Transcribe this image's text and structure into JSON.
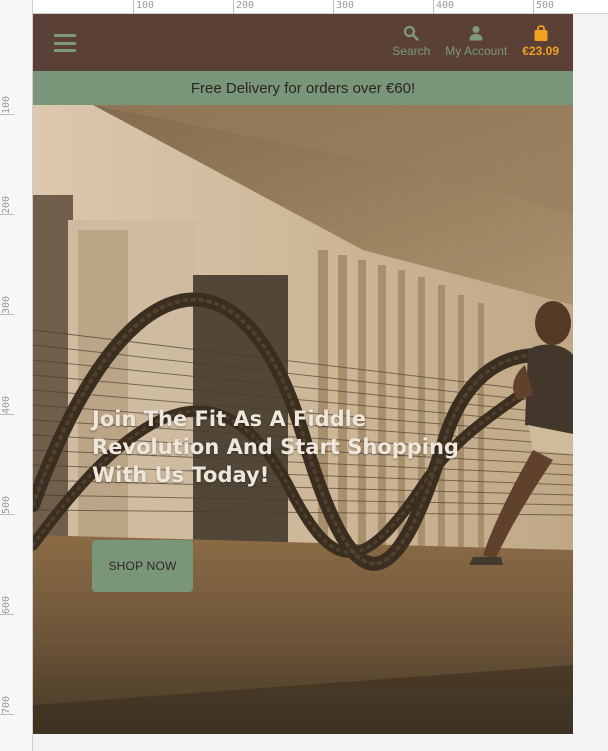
{
  "rulers": {
    "top_ticks": [
      "100",
      "200",
      "300",
      "400",
      "500"
    ],
    "left_ticks": [
      "100",
      "200",
      "300",
      "400",
      "500",
      "600",
      "700"
    ]
  },
  "header": {
    "menu_icon": "hamburger-icon",
    "nav": [
      {
        "label": "Search",
        "icon": "search-icon"
      },
      {
        "label": "My Account",
        "icon": "user-icon"
      },
      {
        "label": "€23.09",
        "icon": "shopping-bag-icon"
      }
    ],
    "colors": {
      "header_bg": "#5a4036",
      "accent_green": "#7a967a",
      "bag_accent": "#f0a11f"
    }
  },
  "promo": {
    "text": "Free Delivery for orders over €60!"
  },
  "hero": {
    "title": "Join The Fit As A Fiddle Revolution And Start Shopping With Us Today!",
    "cta_label": "SHOP NOW"
  }
}
